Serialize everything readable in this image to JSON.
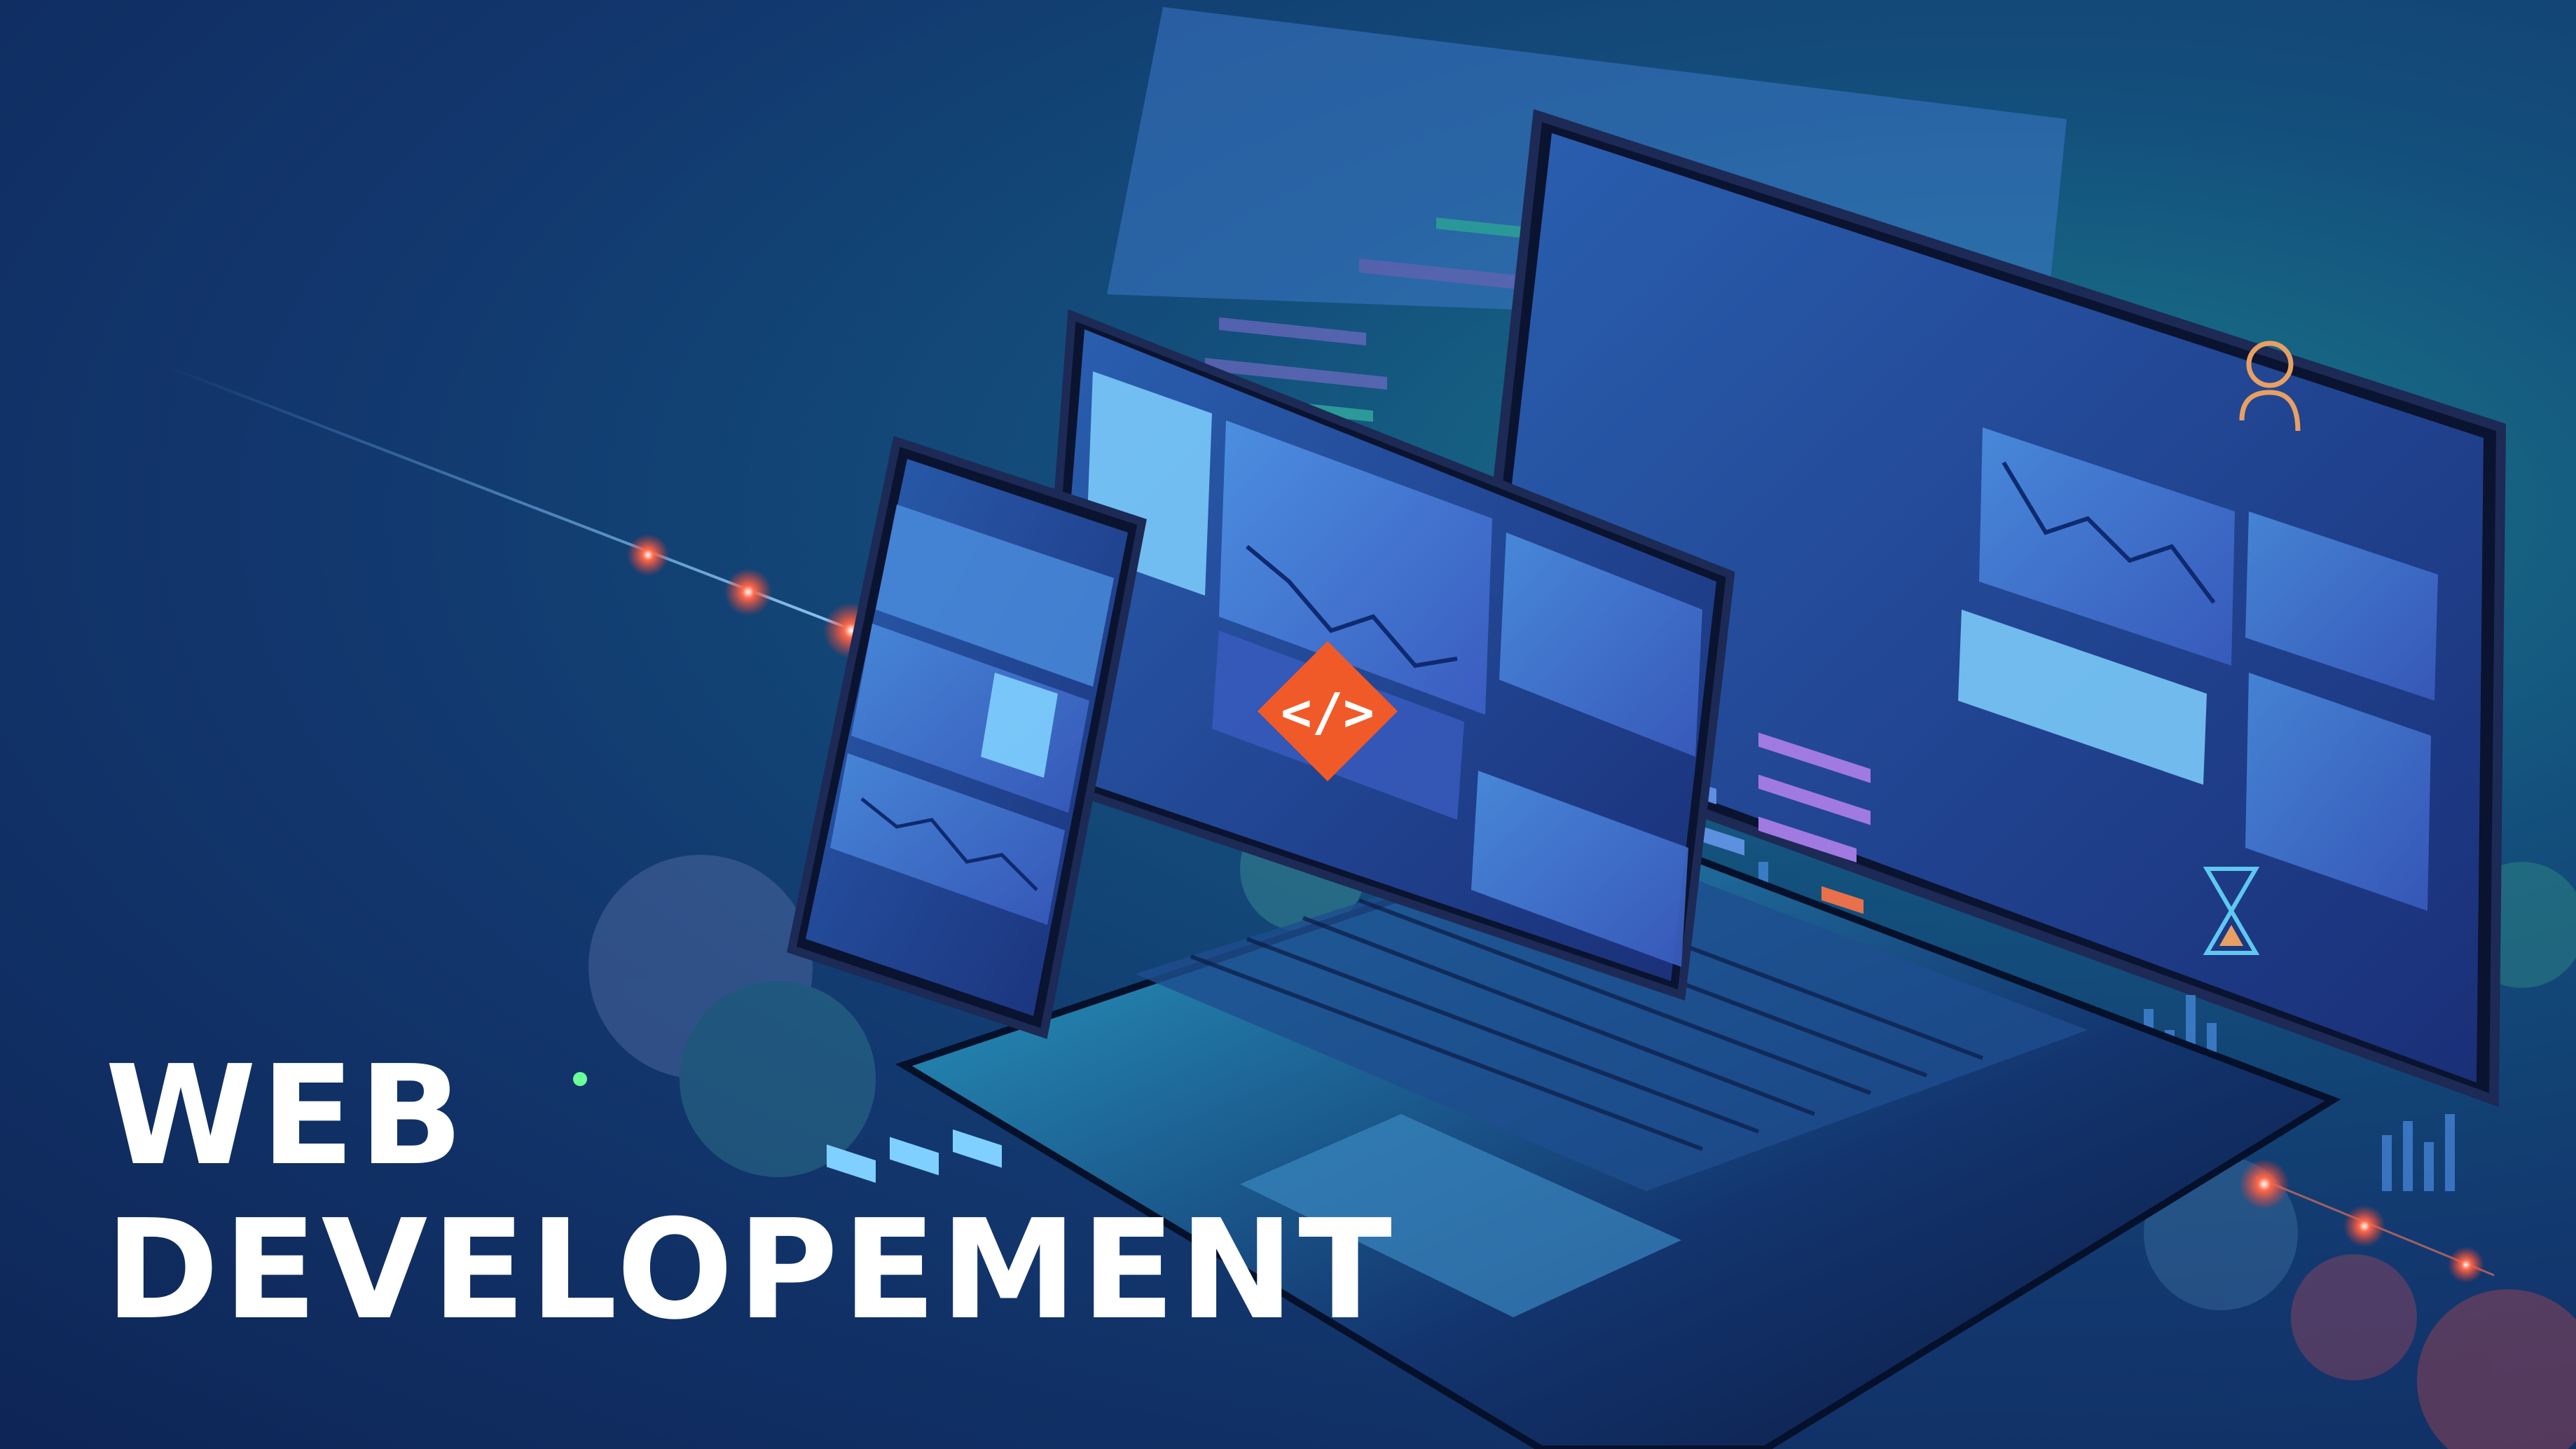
{
  "headline": {
    "line1": "WEB",
    "line2": "DEVELOPEMENT"
  },
  "colors": {
    "background_deep": "#0e2556",
    "background_glow": "#1a7a8a",
    "screen_accent": "#5fb8e8",
    "code_purple": "#8a72d8",
    "code_teal": "#3fd1b0",
    "code_orange": "#e8704a",
    "badge_orange": "#f05a28",
    "light_red": "#ff4a3a"
  },
  "icons": [
    "code-brackets-icon",
    "user-icon",
    "hourglass-icon",
    "chart-line-icon",
    "navigation-icons"
  ]
}
